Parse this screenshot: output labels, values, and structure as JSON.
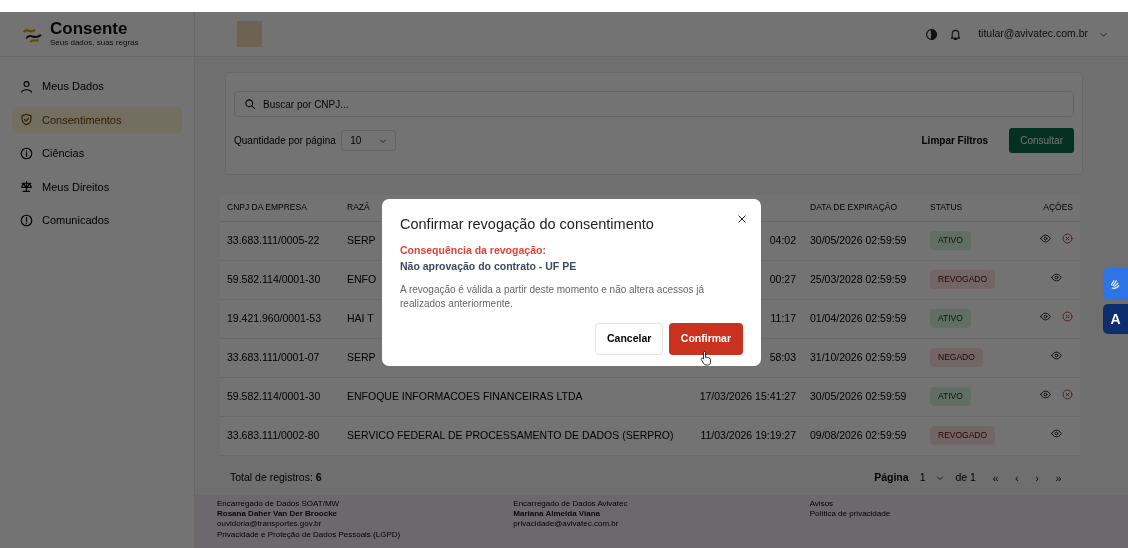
{
  "brand": {
    "name": "Consente",
    "tagline": "Seus dados, suas regras"
  },
  "header": {
    "user_email": "titular@avivatec.com.br"
  },
  "sidebar": {
    "items": [
      {
        "label": "Meus Dados",
        "selected": false
      },
      {
        "label": "Consentimentos",
        "selected": true
      },
      {
        "label": "Ciências",
        "selected": false
      },
      {
        "label": "Meus Direitos",
        "selected": false
      },
      {
        "label": "Comunicados",
        "selected": false
      }
    ]
  },
  "filters": {
    "search_placeholder": "Buscar por CNPJ...",
    "page_size_label": "Quantidade por página",
    "page_size": "10",
    "clear_label": "Limpar Filtros",
    "submit_label": "Consultar"
  },
  "table": {
    "columns": [
      "CNPJ DA EMPRESA",
      "RAZÃ",
      "DATA DE EXPIRAÇÃO",
      "STATUS",
      "AÇÕES"
    ],
    "rows": [
      {
        "cnpj": "33.683.111/0005-22",
        "company": "SERP",
        "created": "04:02",
        "expires": "30/05/2026 02:59:59",
        "status": {
          "label": "ATIVO",
          "kind": "active"
        },
        "revocable": true
      },
      {
        "cnpj": "59.582.114/0001-30",
        "company": "ENFO",
        "created": "00:27",
        "expires": "25/03/2028 02:59:59",
        "status": {
          "label": "REVOGADO",
          "kind": "revoked"
        },
        "revocable": false
      },
      {
        "cnpj": "19.421.960/0001-53",
        "company": "HAI T",
        "created": "11:17",
        "expires": "01/04/2026 02:59:59",
        "status": {
          "label": "ATIVO",
          "kind": "active"
        },
        "revocable": true
      },
      {
        "cnpj": "33.683.111/0001-07",
        "company": "SERP",
        "created": "58:03",
        "expires": "31/10/2026 02:59:59",
        "status": {
          "label": "NEGADO",
          "kind": "denied"
        },
        "revocable": false
      },
      {
        "cnpj": "59.582.114/0001-30",
        "company": "ENFOQUE INFORMACOES FINANCEIRAS LTDA",
        "created": "17/03/2026 15:41:27",
        "expires": "30/05/2026 02:59:59",
        "status": {
          "label": "ATIVO",
          "kind": "active"
        },
        "revocable": true
      },
      {
        "cnpj": "33.683.111/0002-80",
        "company": "SERVICO FEDERAL DE PROCESSAMENTO DE DADOS (SERPRO)",
        "created": "11/03/2026 19:19:27",
        "expires": "09/08/2026 02:59:59",
        "status": {
          "label": "REVOGADO",
          "kind": "revoked"
        },
        "revocable": false
      }
    ]
  },
  "pagination": {
    "total_label": "Total de registros:",
    "total": "6",
    "page_label": "Página",
    "page": "1",
    "of": "de 1",
    "first": "«",
    "prev": "‹",
    "next": "›",
    "last": "»"
  },
  "footer": {
    "columns": [
      {
        "title": "Encarregado de Dados SOAT/MW",
        "name": "Rosana Daher Van Der Broocke",
        "email": "ouvidoria@transportes.gov.br",
        "link": "Privacidade e Proteção de Dados Pessoais (LGPD)"
      },
      {
        "title": "Encarregado de Dados Avivatec",
        "name": "Mariana Almeida Viana",
        "email": "privacidade@avivatec.com.br"
      },
      {
        "title": "Avisos",
        "link": "Política de privacidade"
      }
    ]
  },
  "modal": {
    "title": "Confirmar revogação do consentimento",
    "consequence_label": "Consequência da revogação:",
    "consequence": "Não aprovação do contrato - UF PE",
    "message": "A revogação é válida a partir deste momento e não altera acessos já realizados anteriormente.",
    "cancel": "Cancelar",
    "confirm": "Confirmar"
  },
  "accessibility": {
    "letter": "A"
  }
}
